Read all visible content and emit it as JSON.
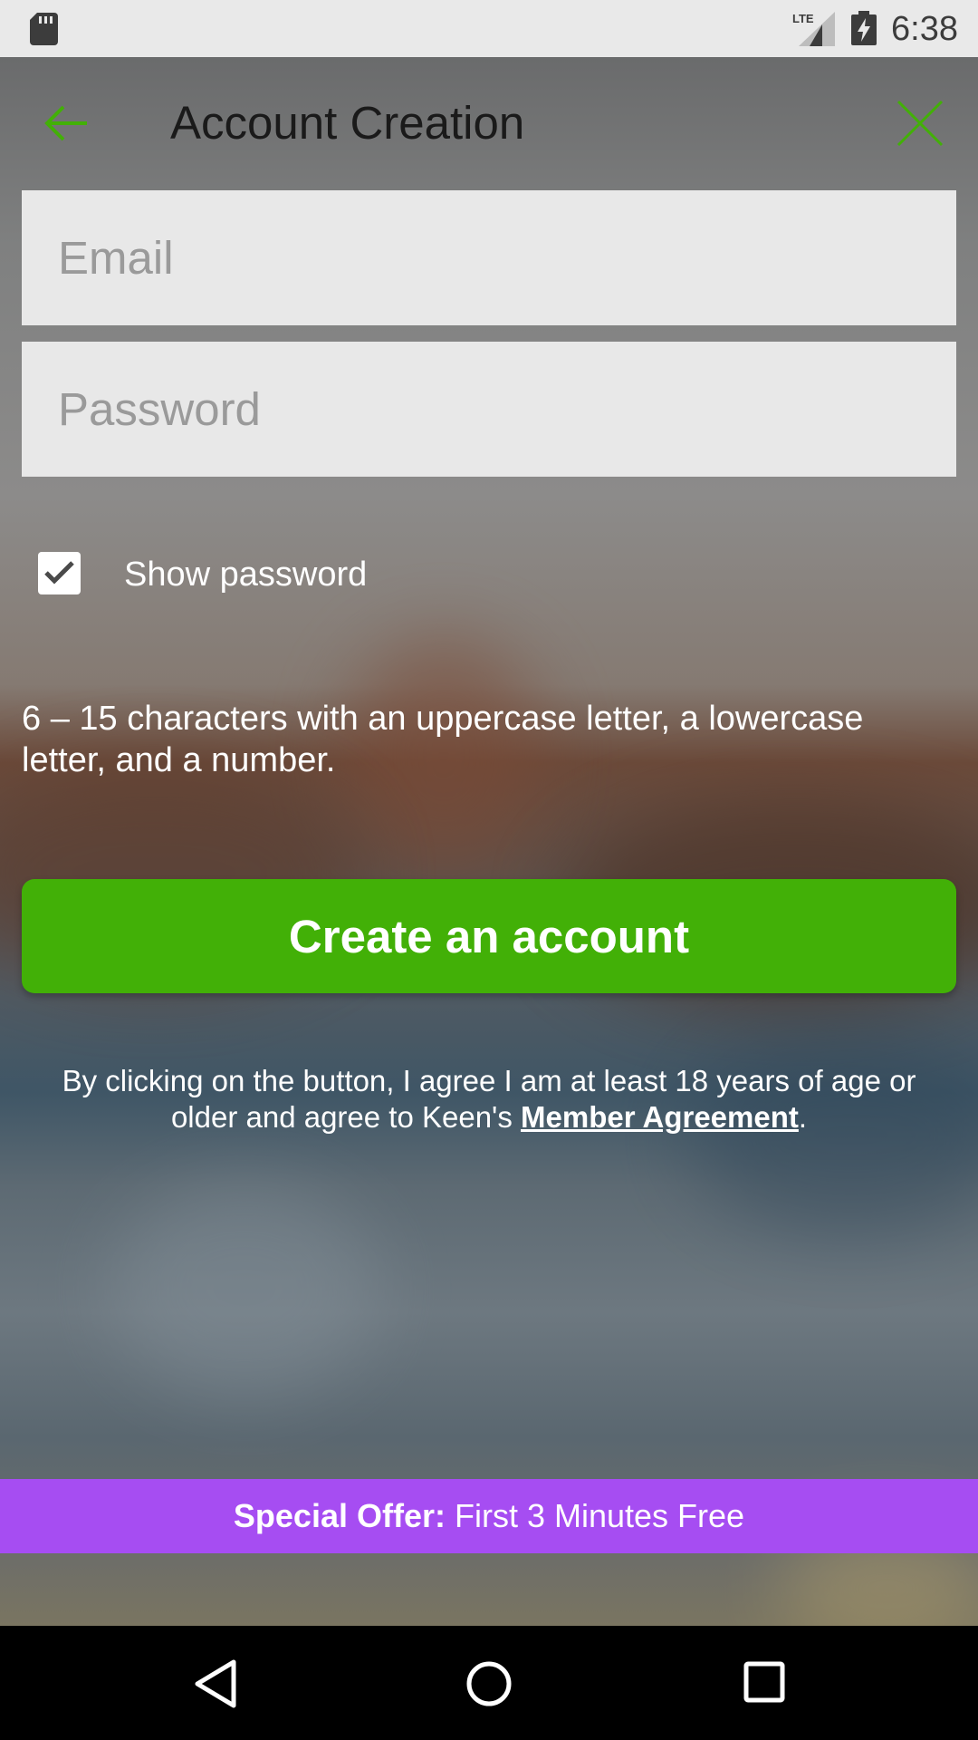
{
  "status_bar": {
    "time": "6:38",
    "network": "LTE",
    "icons": [
      "sd-card-icon",
      "lte-signal-icon",
      "battery-charging-icon"
    ]
  },
  "header": {
    "title": "Account Creation",
    "back_icon": "arrow-left-icon",
    "close_icon": "close-icon"
  },
  "form": {
    "email_placeholder": "Email",
    "email_value": "",
    "password_placeholder": "Password",
    "password_value": "",
    "show_password_label": "Show password",
    "show_password_checked": true,
    "password_hint": "6 – 15 characters with an uppercase letter, a lowercase letter, and a number.",
    "submit_label": "Create an account"
  },
  "agreement": {
    "text": "By clicking on the button, I agree I am at least 18 years of age or older and agree to Keen's",
    "link_label": "Member Agreement",
    "suffix": "."
  },
  "offer": {
    "bold_label": "Special Offer:",
    "text": "First 3 Minutes Free"
  },
  "nav_bar": {
    "icons": [
      "nav-back-icon",
      "nav-home-icon",
      "nav-recent-apps-icon"
    ]
  },
  "colors": {
    "accent_green": "#42b007",
    "offer_purple": "#a64df2",
    "status_bar_bg": "#e9e9e9",
    "field_bg": "#e8e8e8"
  }
}
